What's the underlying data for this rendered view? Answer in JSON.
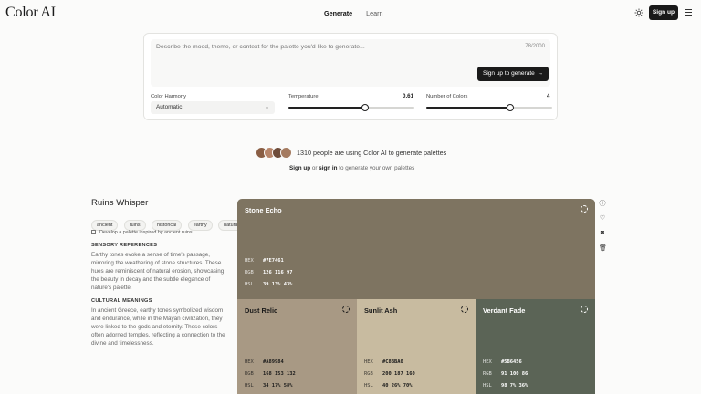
{
  "header": {
    "logo": "Color AI",
    "nav": [
      "Generate",
      "Learn"
    ],
    "signup_label": "Sign up"
  },
  "generator": {
    "prompt_placeholder": "Describe the mood, theme, or context for the palette you'd like to generate...",
    "char_count": "78/2000",
    "generate_label": "Sign up to generate",
    "harmony": {
      "label": "Color Harmony",
      "value": "Automatic"
    },
    "temperature": {
      "label": "Temperature",
      "value": "0.61",
      "level": 0.61
    },
    "num_colors": {
      "label": "Number of Colors",
      "value": "4",
      "level": 0.67
    }
  },
  "social": {
    "users_text": "1310 people are using Color AI to generate palettes",
    "signup_link": "Sign up",
    "or": "or",
    "signin_link": "sign in",
    "suffix": "to generate your own palettes"
  },
  "palette": {
    "title": "Ruins Whisper",
    "tags": [
      "ancient",
      "ruins",
      "historical",
      "earthy",
      "natural"
    ],
    "prompt": "Develop a palette inspired by ancient ruins",
    "sensory_heading": "SENSORY REFERENCES",
    "sensory_body": "Earthy tones evoke a sense of time's passage, mirroring the weathering of stone structures. These hues are reminiscent of natural erosion, showcasing the beauty in decay and the subtle elegance of nature's palette.",
    "cultural_heading": "CULTURAL MEANINGS",
    "cultural_body": "In ancient Greece, earthy tones symbolized wisdom and endurance, while in the Mayan civilization, they were linked to the gods and eternity. These colors often adorned temples, reflecting a connection to the divine and timelessness."
  },
  "swatches": [
    {
      "name": "Stone Echo",
      "hex": "#7E7461",
      "rgb": "126 116 97",
      "hsl": "39 13% 43%",
      "bg": "#7e7461",
      "fg": "#ffffff"
    },
    {
      "name": "Dust Relic",
      "hex": "#A89984",
      "rgb": "168 153 132",
      "hsl": "34 17% 58%",
      "bg": "#a89984",
      "fg": "#1a1a1a"
    },
    {
      "name": "Sunlit Ash",
      "hex": "#C8BBA0",
      "rgb": "200 187 160",
      "hsl": "40 26% 70%",
      "bg": "#c8bba0",
      "fg": "#1a1a1a"
    },
    {
      "name": "Verdant Fade",
      "hex": "#5B6456",
      "rgb": "91 100 86",
      "hsl": "98 7% 36%",
      "bg": "#5b6456",
      "fg": "#ffffff"
    }
  ],
  "labels": {
    "hex": "HEX",
    "rgb": "RGB",
    "hsl": "HSL"
  },
  "side_icons": [
    "info-icon",
    "heart-icon",
    "camera-icon",
    "trash-icon"
  ]
}
